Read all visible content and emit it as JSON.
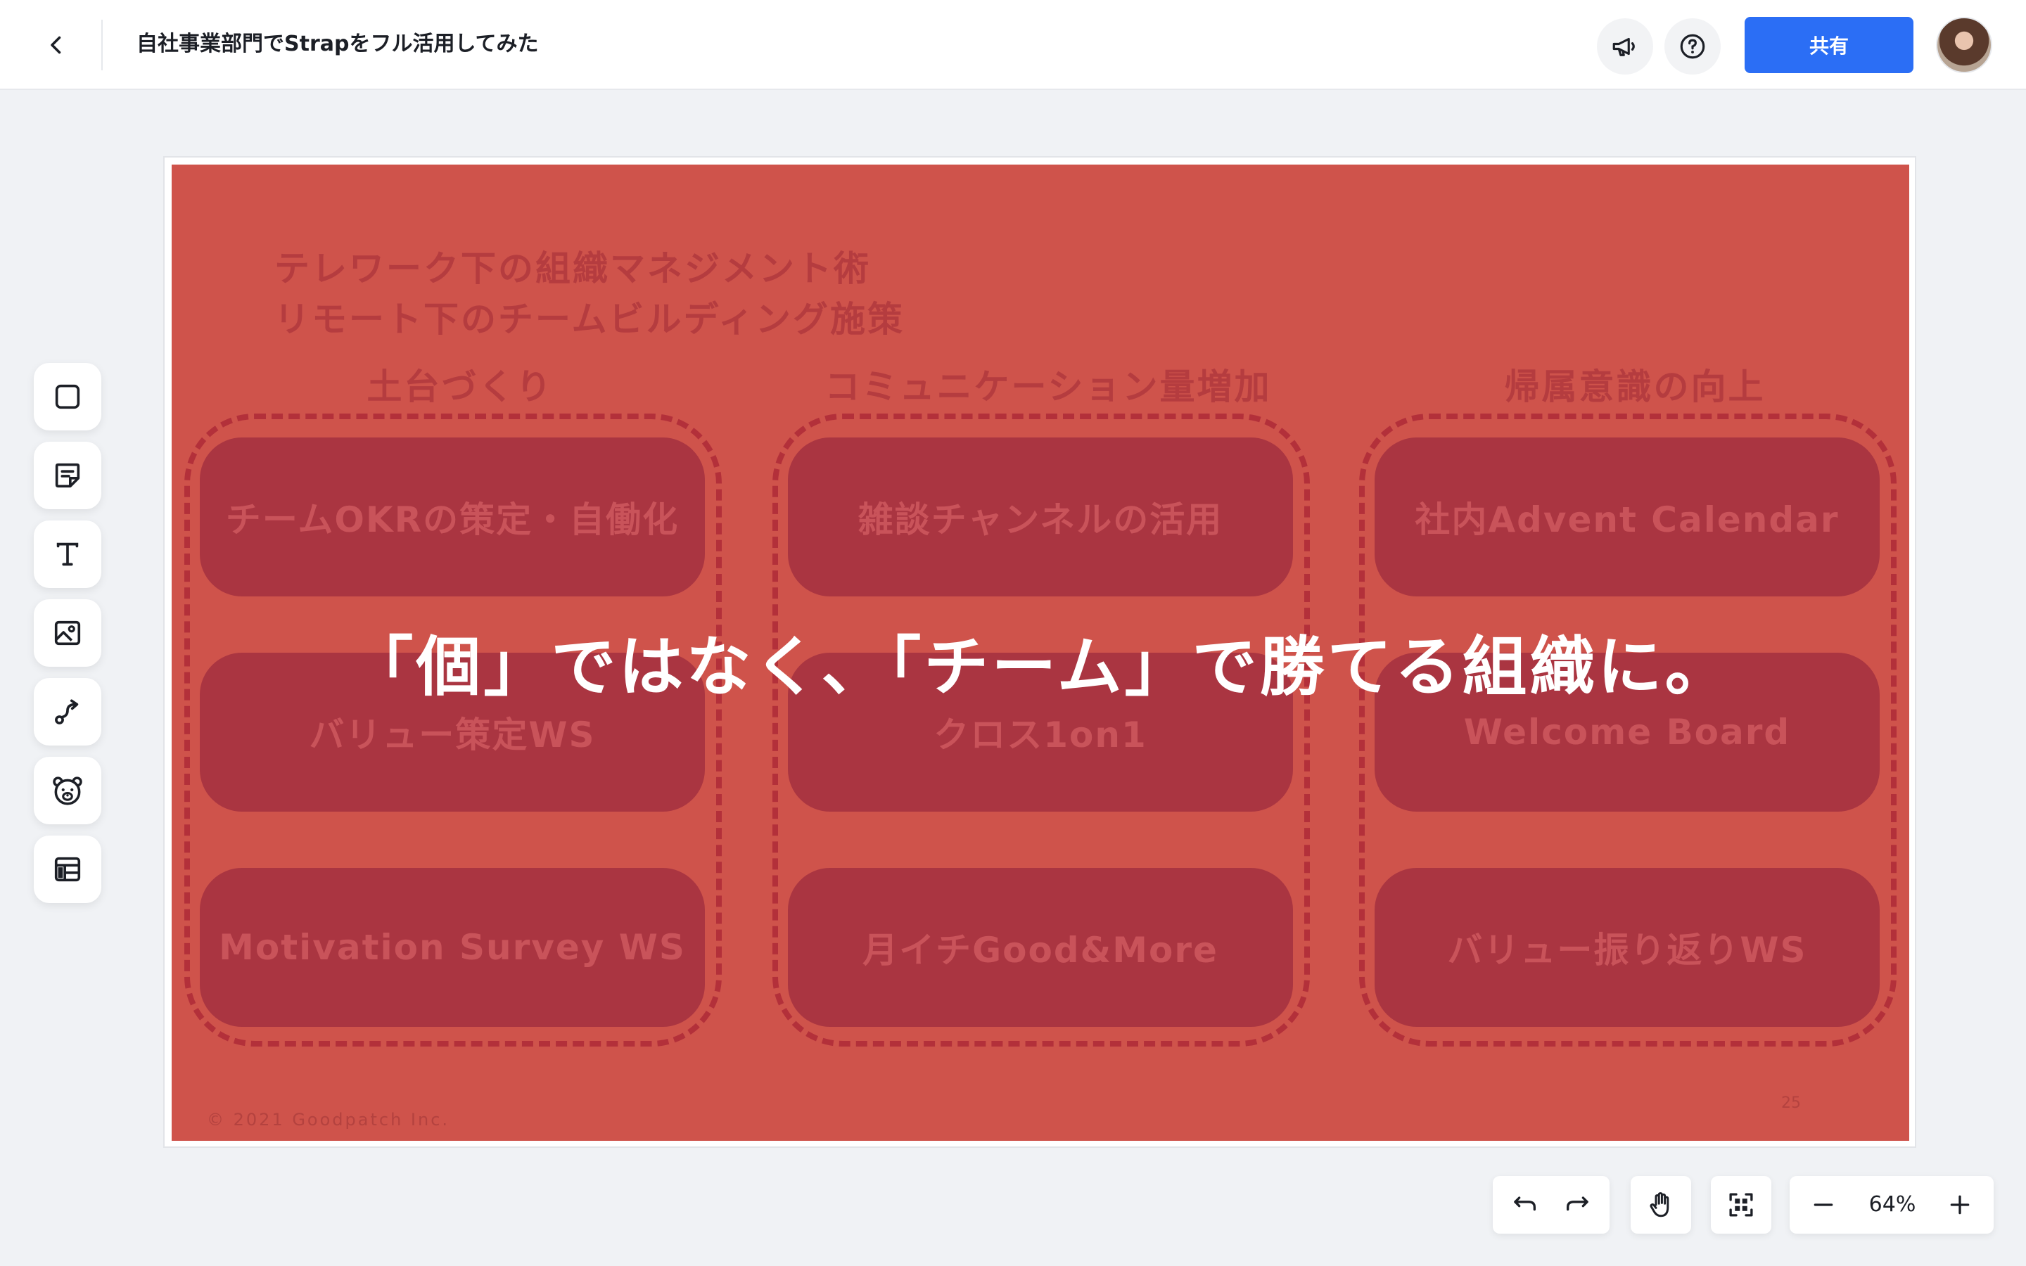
{
  "header": {
    "title": "自社事業部門でStrapをフル活用してみた",
    "share_label": "共有"
  },
  "toolbar": {
    "tools": [
      "rectangle-tool-icon",
      "sticky-note-icon",
      "text-tool-icon",
      "image-tool-icon",
      "connector-tool-icon",
      "bear-stamp-icon",
      "template-icon"
    ]
  },
  "slide": {
    "heading_line1": "テレワーク下の組織マネジメント術",
    "heading_line2": "リモート下のチームビルディング施策",
    "columns": [
      {
        "label": "土台づくり",
        "items": [
          "チームOKRの策定・自働化",
          "バリュー策定WS",
          "Motivation Survey WS"
        ]
      },
      {
        "label": "コミュニケーション量増加",
        "items": [
          "雑談チャンネルの活用",
          "クロス1on1",
          "月イチGood&More"
        ]
      },
      {
        "label": "帰属意識の向上",
        "items": [
          "社内Advent Calendar",
          "Welcome Board",
          "バリュー振り返りWS"
        ]
      }
    ],
    "overlay_text": "「個」ではなく、「チーム」で勝てる組織に。",
    "copyright": "© 2021 Goodpatch Inc.",
    "page_number": "25",
    "colors": {
      "background": "#cf534b",
      "pill": "#aa3541",
      "accent_text": "#b53c3f"
    }
  },
  "zoom": {
    "level": "64%"
  }
}
